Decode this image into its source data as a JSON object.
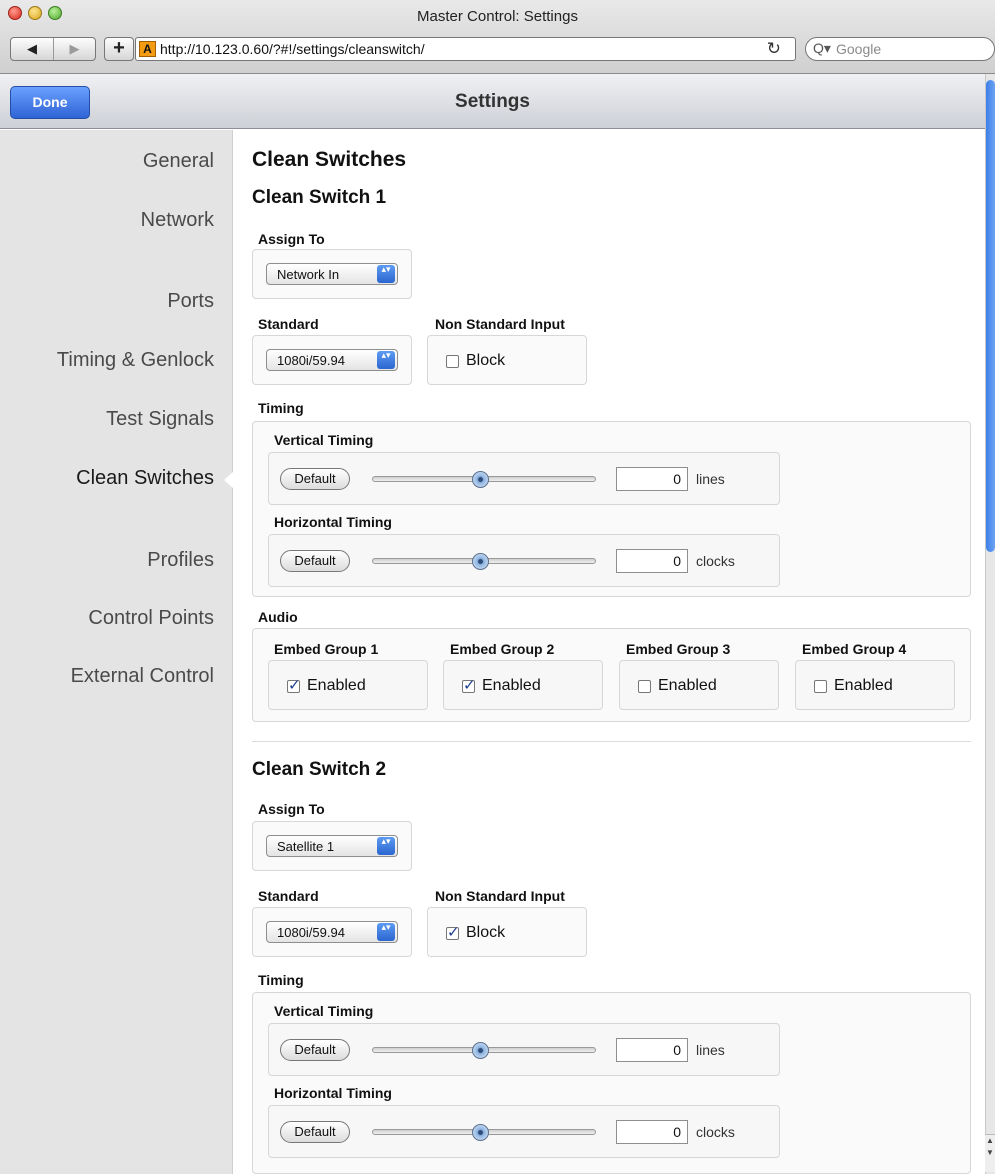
{
  "window": {
    "title": "Master Control: Settings"
  },
  "toolbar": {
    "back_icon": "◀",
    "forward_icon": "▶",
    "new_tab_icon": "+",
    "site_icon_letter": "A",
    "url": "http://10.123.0.60/?#!/settings/cleanswitch/",
    "reload_icon": "↻",
    "search_icon": "Q▾",
    "search_placeholder": "Google"
  },
  "header": {
    "done_label": "Done",
    "title": "Settings"
  },
  "sidebar": {
    "items": [
      {
        "label": "General",
        "active": false
      },
      {
        "label": "Network",
        "active": false
      },
      {
        "label": "Ports",
        "active": false
      },
      {
        "label": "Timing & Genlock",
        "active": false
      },
      {
        "label": "Test Signals",
        "active": false
      },
      {
        "label": "Clean Switches",
        "active": true
      },
      {
        "label": "Profiles",
        "active": false
      },
      {
        "label": "Control Points",
        "active": false
      },
      {
        "label": "External Control",
        "active": false
      }
    ]
  },
  "page": {
    "title": "Clean Switches"
  },
  "labels": {
    "assign_to": "Assign To",
    "standard": "Standard",
    "non_standard_input": "Non Standard Input",
    "block": "Block",
    "timing": "Timing",
    "vertical_timing": "Vertical Timing",
    "horizontal_timing": "Horizontal Timing",
    "default": "Default",
    "lines": "lines",
    "clocks": "clocks",
    "audio": "Audio",
    "enabled": "Enabled",
    "select_arrow_icon": "▴▾"
  },
  "clean_switches": [
    {
      "title": "Clean Switch 1",
      "assign_to": "Network In",
      "standard": "1080i/59.94",
      "block_checked": false,
      "vertical_timing": "0",
      "vertical_slider_level": 0.5,
      "horizontal_timing": "0",
      "horizontal_slider_level": 0.5,
      "audio_groups": [
        {
          "label": "Embed Group 1",
          "enabled": true
        },
        {
          "label": "Embed Group 2",
          "enabled": true
        },
        {
          "label": "Embed Group 3",
          "enabled": false
        },
        {
          "label": "Embed Group 4",
          "enabled": false
        }
      ]
    },
    {
      "title": "Clean Switch 2",
      "assign_to": "Satellite 1",
      "standard": "1080i/59.94",
      "block_checked": true,
      "vertical_timing": "0",
      "vertical_slider_level": 0.5,
      "horizontal_timing": "0",
      "horizontal_slider_level": 0.5
    }
  ],
  "colors": {
    "done_button": "#2f64d6",
    "scroll_thumb": "#3d7fe8"
  }
}
